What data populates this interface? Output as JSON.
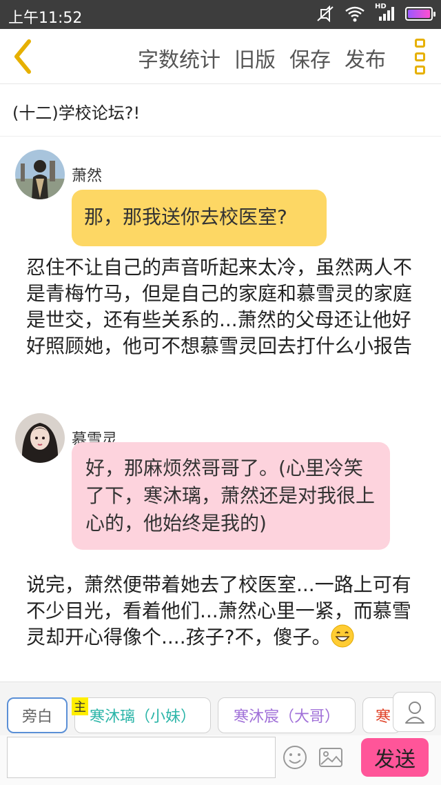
{
  "status_bar": {
    "time": "上午11:52",
    "network": "HD",
    "icons": [
      "mute-vibrate-icon",
      "wifi-icon",
      "signal-icon",
      "battery-icon"
    ],
    "battery_color": "#c060ff"
  },
  "toolbar": {
    "back_icon": "chevron-left-icon",
    "actions": [
      "字数统计",
      "旧版",
      "保存",
      "发布"
    ],
    "menu_icon": "vertical-menu-icon",
    "accent": "#e6b000"
  },
  "chapter_title": "(十二)学校论坛?!",
  "messages": [
    {
      "type": "dialogue",
      "sender": "萧然",
      "text": "那，那我送你去校医室?",
      "bubble_color": "#fdd764"
    },
    {
      "type": "narration",
      "text": "忍住不让自己的声音听起来太冷，虽然两人不是青梅竹马，但是自己的家庭和慕雪灵的家庭是世交，还有些关系的...萧然的父母还让他好好照顾她，他可不想慕雪灵回去打什么小报告"
    },
    {
      "type": "dialogue",
      "sender": "慕雪灵",
      "text": "好，那麻烦然哥哥了。(心里冷笑了下，寒沐璃，萧然还是对我很上心的，他始终是我的)",
      "bubble_color": "#fdd3dd"
    },
    {
      "type": "narration",
      "text": "说完，萧然便带着她去了校医室...一路上可有不少目光，看着他们...萧然心里一紧，而慕雪灵却开心得像个....孩子?不，傻子。",
      "emoji": "grinning-face-icon"
    }
  ],
  "characters": {
    "host_tag": "主",
    "items": [
      {
        "label": "旁白",
        "color": "#666666",
        "selected": true
      },
      {
        "label": "寒沐璃（小妹）",
        "color": "#2bb5a8",
        "selected": false
      },
      {
        "label": "寒沐宸（大哥）",
        "color": "#a070d8",
        "selected": false
      },
      {
        "label": "寒",
        "color": "#e0442a",
        "selected": false
      }
    ],
    "profile_icon": "person-icon"
  },
  "input_bar": {
    "placeholder": "",
    "emoji_icon": "smiley-icon",
    "image_icon": "image-icon",
    "send_label": "发送",
    "send_color": "#ff5599"
  }
}
